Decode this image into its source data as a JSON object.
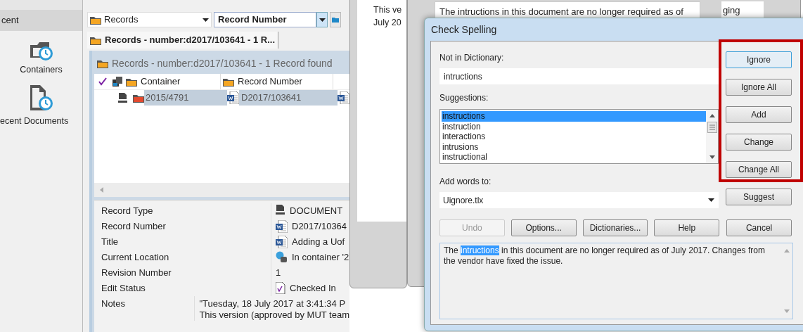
{
  "sidebar": {
    "header": "cent",
    "items": [
      {
        "label": "Containers",
        "kind": "containers"
      },
      {
        "label": "ecent Documents",
        "kind": "documents"
      }
    ]
  },
  "toolbar": {
    "record_type_dropdown": "Records",
    "search_field": "Record Number"
  },
  "tabs": [
    {
      "label": "Records - number:d2017/103641 - 1 R...",
      "selected": true
    }
  ],
  "results": {
    "title": "Records - number:d2017/103641 - 1 Record found",
    "columns": [
      "Container",
      "Record Number"
    ],
    "rows": [
      {
        "container": "2015/4791",
        "record_number": "D2017/103641",
        "selected": true
      }
    ]
  },
  "details": [
    {
      "label": "Record Type",
      "value_lines": [
        "DOCUMENT"
      ],
      "kind": "type"
    },
    {
      "label": "Record Number",
      "value_lines": [
        "D2017/10364"
      ],
      "kind": "word"
    },
    {
      "label": "Title",
      "value_lines": [
        "Adding a Uof"
      ],
      "kind": "word"
    },
    {
      "label": "Current Location",
      "value_lines": [
        "In container '2"
      ],
      "kind": "location"
    },
    {
      "label": "Revision Number",
      "value_lines": [
        "1"
      ],
      "kind": "plain"
    },
    {
      "label": "Edit Status",
      "value_lines": [
        "Checked In"
      ],
      "kind": "checked"
    },
    {
      "label": "Notes",
      "value_lines": [
        "\"Tuesday, 18 July 2017 at 3:41:34 P",
        "This version (approved by MUT team"
      ],
      "kind": "plain"
    }
  ],
  "back_windows": [
    {
      "lines": [
        "This ve",
        "July 20"
      ]
    },
    {
      "lines": [
        "The intructions in this document are no longer required as of",
        "ging"
      ]
    }
  ],
  "dialog": {
    "title": "Check Spelling",
    "not_in_dictionary": {
      "label": "Not in Dictionary:",
      "value": "intructions"
    },
    "suggestions": {
      "label": "Suggestions:",
      "items": [
        {
          "text": "instructions",
          "selected": true
        },
        {
          "text": "instruction",
          "selected": false
        },
        {
          "text": "interactions",
          "selected": false
        },
        {
          "text": "intrusions",
          "selected": false
        },
        {
          "text": "instructional",
          "selected": false
        }
      ]
    },
    "add_words_to": {
      "label": "Add words to:",
      "value": "Uignore.tlx"
    },
    "side_buttons": [
      {
        "label": "Ignore",
        "focused": true
      },
      {
        "label": "Ignore All",
        "focused": false
      },
      {
        "label": "Add",
        "focused": false
      },
      {
        "label": "Change",
        "focused": false
      },
      {
        "label": "Change All",
        "focused": false
      },
      {
        "label": "Suggest",
        "focused": false
      }
    ],
    "bottom_buttons": [
      {
        "label": "Undo",
        "disabled": true
      },
      {
        "label": "Options...",
        "disabled": false
      },
      {
        "label": "Dictionaries...",
        "disabled": false
      },
      {
        "label": "Help",
        "disabled": false
      },
      {
        "label": "Cancel",
        "disabled": false
      }
    ],
    "context": {
      "before": "The ",
      "flagged": "intructions",
      "after": " in this document are no longer required as of July 2017. Changes from the vendor have fixed the issue."
    }
  }
}
